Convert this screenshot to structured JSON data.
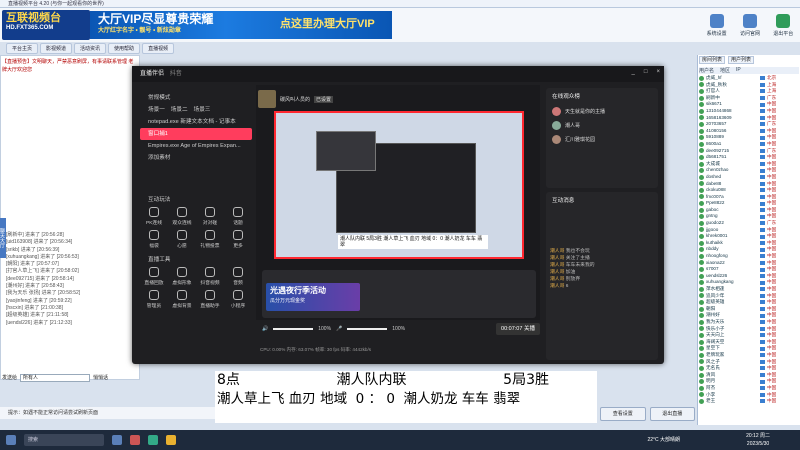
{
  "app": {
    "title": "直播视频平台 4.20 (与你一起观看你的世界)"
  },
  "banner": {
    "logo_main": "互联视频台",
    "logo_sub": "HD.FXT365.COM",
    "vip_text": "大厅VIP尽显尊贵荣耀",
    "vip_sub": "大厅红字名字 • 靓号 • 新炫勋章",
    "vip_link": "点这里办理大厅VIP"
  },
  "top_icons": [
    {
      "label": "系统设置",
      "icon": "gear-icon"
    },
    {
      "label": "访问官网",
      "icon": "home-icon"
    },
    {
      "label": "退出平台",
      "icon": "exit-icon"
    }
  ],
  "nav": {
    "tabs": [
      "平台主页",
      "影视频道",
      "活动资讯",
      "使用帮助",
      "直播视频"
    ]
  },
  "left": {
    "announce": "【直播预告】文明聊天，严禁恶意刷屏，有事请联系管理 老牌大厅欢迎您",
    "side_tab": "聊天大厅",
    "messages": [
      "[刷新中] 进来了 [20:56:28]",
      "[uid163908] 进来了 [20:56:34]",
      "[srikb] 进来了 [20:56:39]",
      "[xuhuangkang] 进来了 [20:56:53]",
      "[朝阳] 进来了 [20:57:07]",
      "[打官人草上飞] 进来了 [20:58:02]",
      "[dee092715] 进来了 [20:58:14]",
      "[潮州好] 进来了 [20:58:43]",
      "[我为天乐 张扬] 进来了 [20:58:52]",
      "[yaojinfeng] 进来了 [20:59:22]",
      "[hscxin] 进来了 [21:00:38]",
      "[超级英雄] 进来了 [21:11:58]",
      "[uendsl226] 进来了 [21:12:33]"
    ],
    "say_label": "发送给",
    "say_target": "所有人",
    "checkbox_label": "悄悄话"
  },
  "status": {
    "hint": "提示：如遇不能正常访问请尝试刷新页面"
  },
  "bottom_buttons": [
    "查看设置",
    "退出直播"
  ],
  "right": {
    "tabs": [
      "房间列表",
      "用户列表"
    ],
    "header": [
      "用户名",
      "地区",
      "IP"
    ],
    "users": [
      {
        "name": "虎威_hf",
        "region": "北京"
      },
      {
        "name": "虎威_秋秋",
        "region": "上海"
      },
      {
        "name": "打官人",
        "region": "上海"
      },
      {
        "name": "刷新中",
        "region": "广东"
      },
      {
        "name": "sik6671",
        "region": "中国"
      },
      {
        "name": "1310444868",
        "region": "中国"
      },
      {
        "name": "1658163609",
        "region": "中国"
      },
      {
        "name": "20703657",
        "region": "广东"
      },
      {
        "name": "41080156",
        "region": "中国"
      },
      {
        "name": "5910889",
        "region": "中国"
      },
      {
        "name": "8600a1",
        "region": "中国"
      },
      {
        "name": "dee092715",
        "region": "广东"
      },
      {
        "name": "d5681751",
        "region": "中国"
      },
      {
        "name": "大成城",
        "region": "中国"
      },
      {
        "name": "chen0zhao",
        "region": "中国"
      },
      {
        "name": "doshed",
        "region": "中国"
      },
      {
        "name": "dabe88",
        "region": "中国"
      },
      {
        "name": "ckoku088",
        "region": "中国"
      },
      {
        "name": "fmc007a",
        "region": "中国"
      },
      {
        "name": "Ppe8822",
        "region": "中国"
      },
      {
        "name": "gaboc",
        "region": "中国"
      },
      {
        "name": "gntng",
        "region": "中国"
      },
      {
        "name": "guodo22",
        "region": "广东"
      },
      {
        "name": "jjgooo",
        "region": "中国"
      },
      {
        "name": "khrek0001",
        "region": "中国"
      },
      {
        "name": "kuthaikk",
        "region": "中国"
      },
      {
        "name": "nbddy",
        "region": "中国"
      },
      {
        "name": "nhoogfong",
        "region": "中国"
      },
      {
        "name": "xiaona22",
        "region": "中国"
      },
      {
        "name": "s7007",
        "region": "中国"
      },
      {
        "name": "uendsl226",
        "region": "中国"
      },
      {
        "name": "xuhuangkang",
        "region": "中国"
      },
      {
        "name": "萍水相逢",
        "region": "中国"
      },
      {
        "name": "追风少年",
        "region": "中国"
      },
      {
        "name": "超级英雄",
        "region": "中国"
      },
      {
        "name": "朝阳",
        "region": "中国"
      },
      {
        "name": "潮州好",
        "region": "中国"
      },
      {
        "name": "我为天乐",
        "region": "中国"
      },
      {
        "name": "快乐小子",
        "region": "中国"
      },
      {
        "name": "天天向上",
        "region": "中国"
      },
      {
        "name": "海阔天空",
        "region": "中国"
      },
      {
        "name": "星空下",
        "region": "中国"
      },
      {
        "name": "老牌玩家",
        "region": "中国"
      },
      {
        "name": "风之子",
        "region": "中国"
      },
      {
        "name": "无名氏",
        "region": "中国"
      },
      {
        "name": "清风",
        "region": "中国"
      },
      {
        "name": "明月",
        "region": "中国"
      },
      {
        "name": "阿杰",
        "region": "中国"
      },
      {
        "name": "小李",
        "region": "中国"
      },
      {
        "name": "老王",
        "region": "中国"
      }
    ]
  },
  "overlay": {
    "title": "直播伴侣",
    "subtitle": "抖音",
    "window_controls": [
      "_",
      "□",
      "×"
    ],
    "mode_label": "常规模式",
    "scene_tabs": [
      "场景一",
      "场景二",
      "场景三"
    ],
    "scenes": [
      "notepad.exe 新建文本文档 - 记事本",
      "窗口捕1",
      "Empires.exe Age of Empires Expan..."
    ],
    "add_material": "添加素材",
    "interactive_label": "互动玩法",
    "tools": [
      "PK连线",
      "观众连线",
      "对对碰",
      "话题",
      "福袋",
      "心愿",
      "礼物投票",
      "更多"
    ],
    "live_tools_label": "直播工具",
    "live_tools": [
      "直播回放",
      "虚拟形象",
      "抖音视频",
      "音频",
      "管理员",
      "虚拟背景",
      "直播助手",
      "小程序"
    ],
    "user_name": "碳风叫人员的",
    "user_badge": "已设置",
    "caption": "潮人队内联 5局3胜 潮人草上飞 血刃 地域 0：0 潮人奶龙 车车 翡翠",
    "activity_title": "光遇夜行季活动",
    "activity_sub": "瓜分万元现金奖",
    "mic_volume": "100%",
    "speaker_volume": "100%",
    "timer": "00:07:07",
    "end_live": "关播",
    "stats": "CPU: 0.00%  内存: 63.07%  帧率: 30 fps  码率: 4442kb/s",
    "rank_title": "在线观众榜",
    "rank_users": [
      "天生就是你的主播",
      "潮人哥",
      "汇川雅琪花园"
    ],
    "chat_title": "互动消息",
    "chat_lines": [
      {
        "user": "潮人哥",
        "text": "我也不会玩"
      },
      {
        "user": "潮人哥",
        "text": "关注了主播"
      },
      {
        "user": "潮人哥",
        "text": "车车未来我的"
      },
      {
        "user": "潮人哥",
        "text": "加油"
      },
      {
        "user": "潮人哥",
        "text": "别放弃"
      },
      {
        "user": "潮人哥",
        "text": "6"
      }
    ]
  },
  "bottom_overlay": {
    "line1_a": "8点",
    "line1_b": "潮人队内联",
    "line1_c": "5局3胜",
    "line2": "潮人草上飞 血刃 地域  0 ： 0  潮人奶龙 车车 翡翠"
  },
  "taskbar": {
    "search_placeholder": "搜索",
    "weather": "22°C 大部晴朗",
    "time": "20:12 周二",
    "date": "2023/5/30"
  }
}
